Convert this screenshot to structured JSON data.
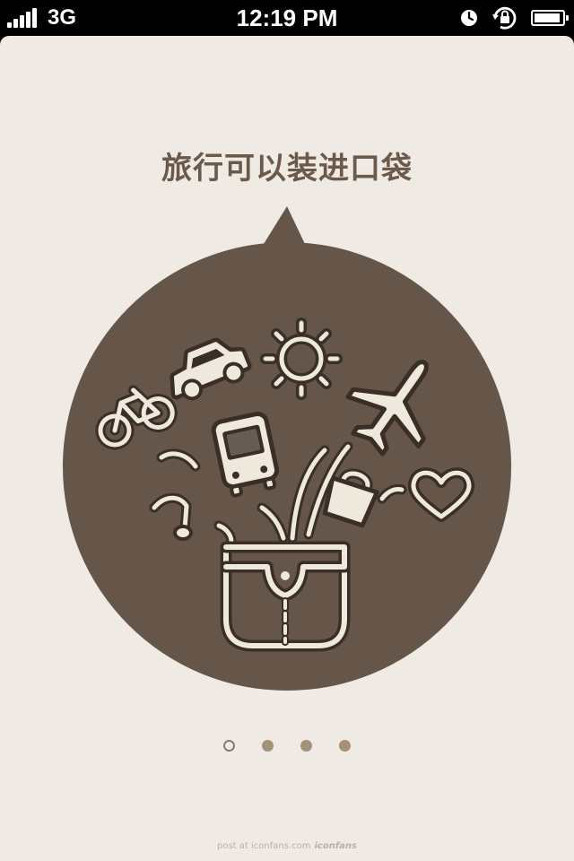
{
  "status_bar": {
    "carrier": "3G",
    "time": "12:19 PM",
    "icons": [
      "signal-icon",
      "alarm-clock-icon",
      "rotation-lock-icon",
      "battery-icon"
    ]
  },
  "onboarding": {
    "headline": "旅行可以装进口袋",
    "illustration_icons": [
      "bicycle-icon",
      "car-icon",
      "sun-icon",
      "airplane-icon",
      "bus-icon",
      "music-note-icon",
      "handbag-icon",
      "heart-icon",
      "pocket-icon"
    ],
    "page_count": 4,
    "current_page": 1
  },
  "footer": {
    "text": "post at iconfans.com",
    "brand": "iconfans"
  },
  "colors": {
    "background": "#efebe4",
    "bubble": "#66564a",
    "icon_fill": "#efe8dc",
    "icon_outline": "#3a2e26",
    "headline": "#6b5a4c",
    "dot_inactive": "#a3917a"
  }
}
